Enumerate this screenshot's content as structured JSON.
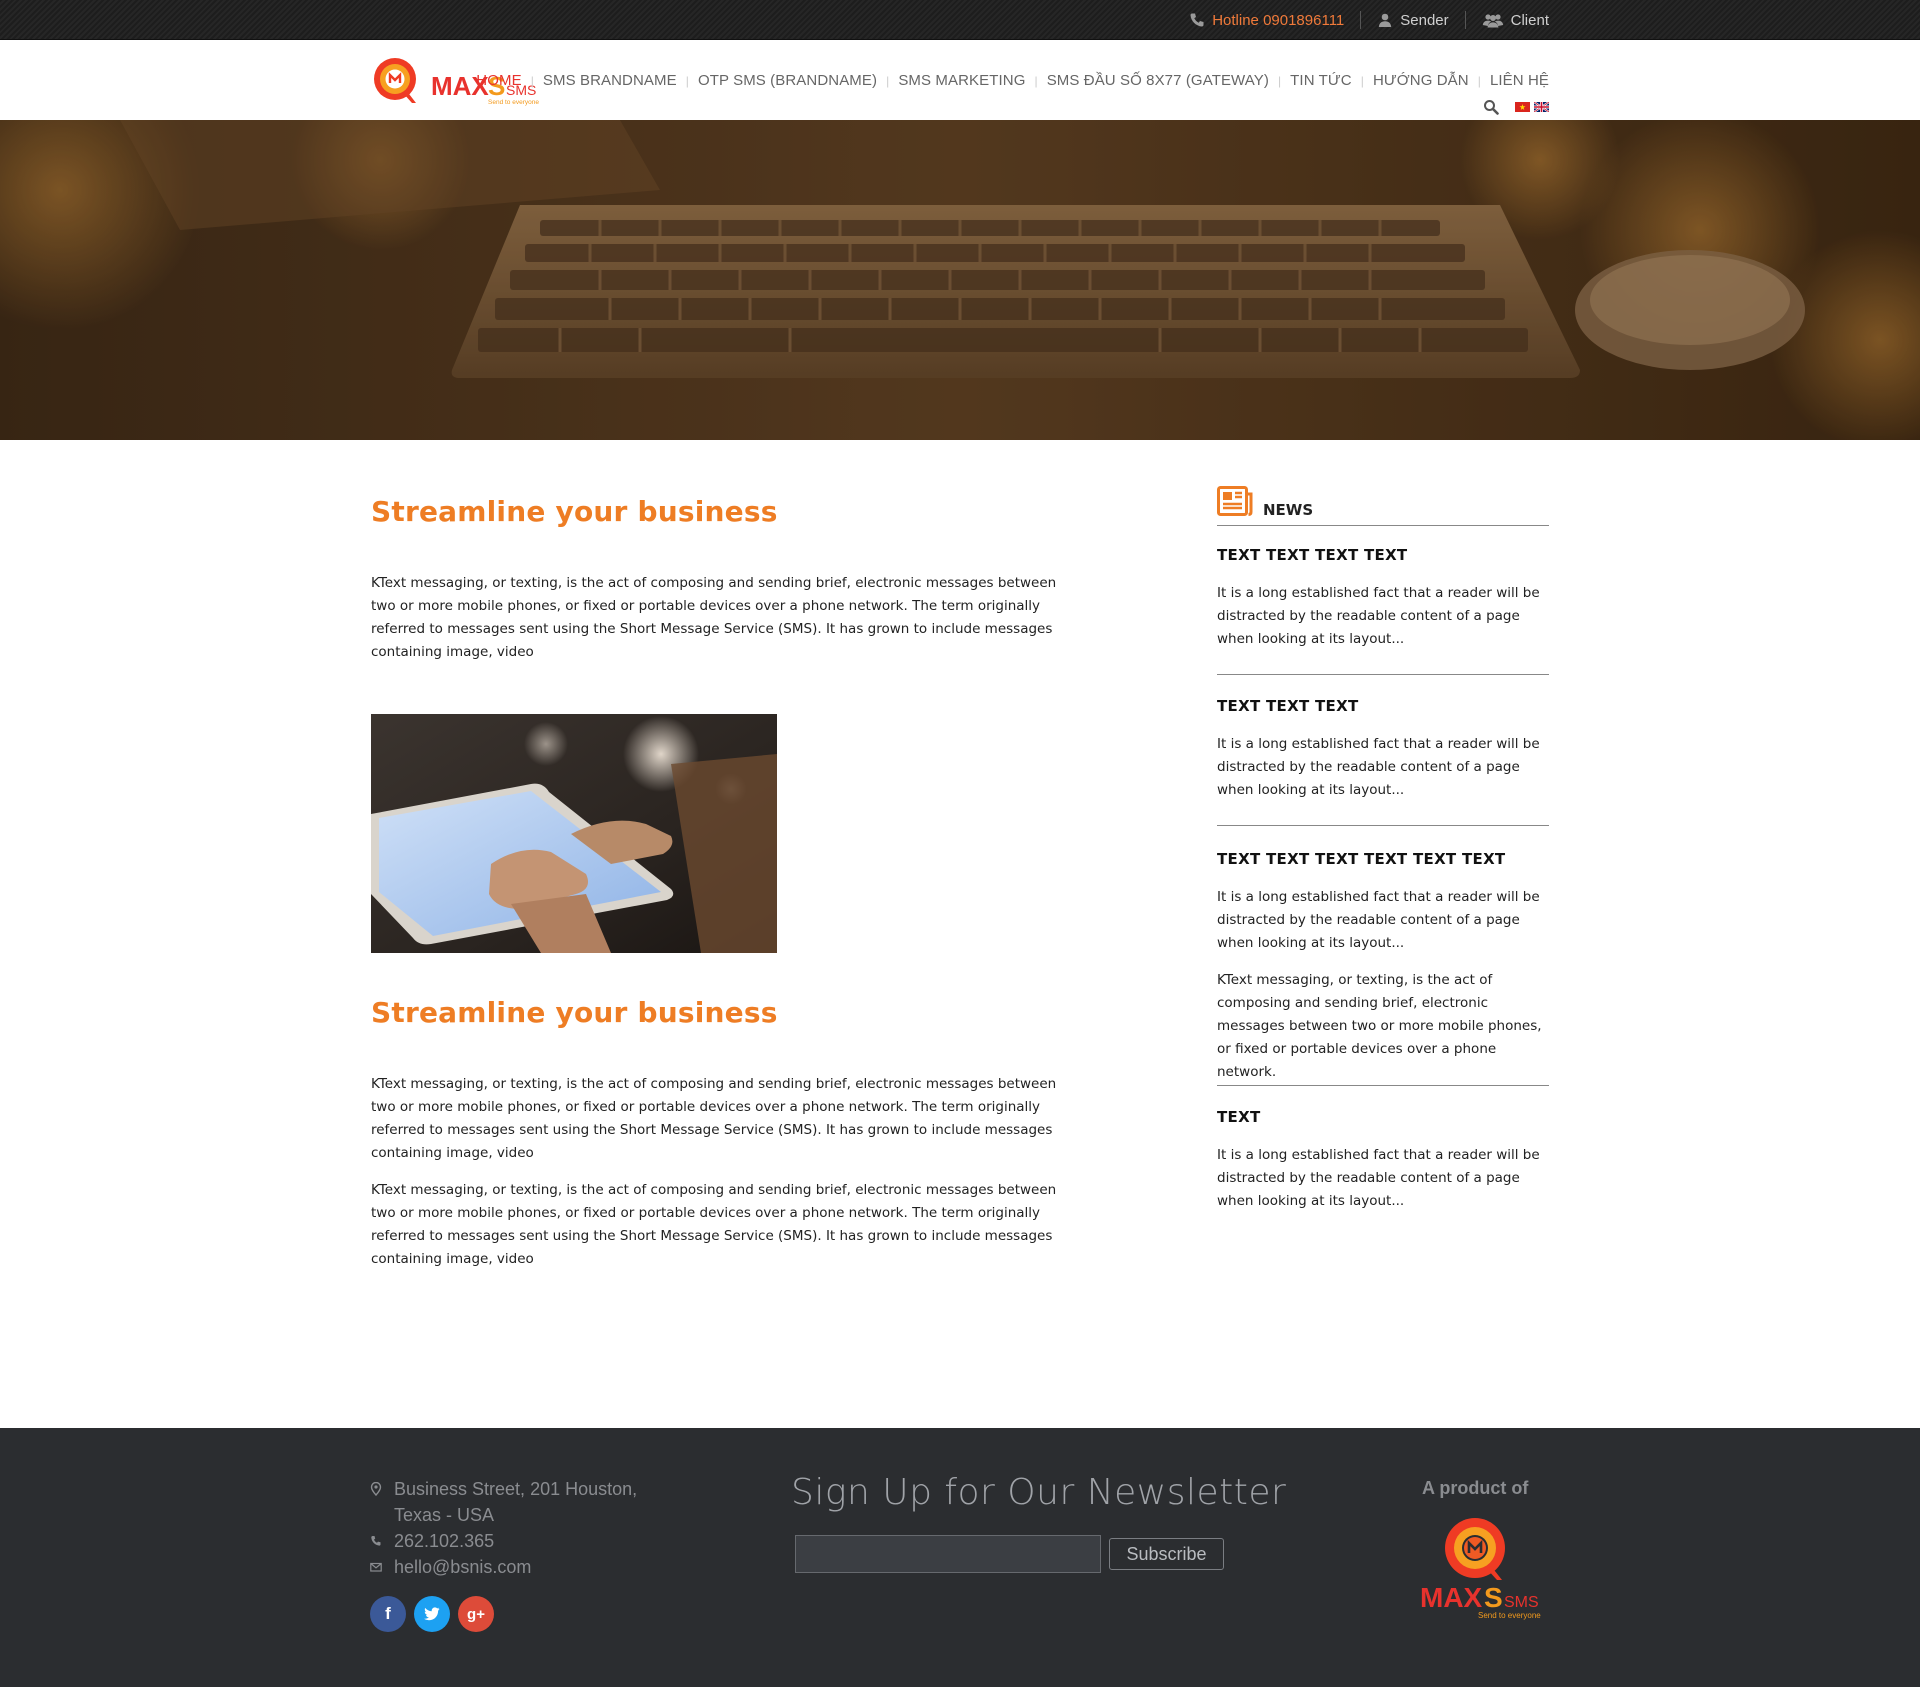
{
  "topbar": {
    "hotline": "Hotline 0901896111",
    "sender": "Sender",
    "client": "Client"
  },
  "brand": {
    "logo_main": "MAX",
    "logo_s": "S",
    "logo_sms": "SMS",
    "logo_tagline": "Send to everyone",
    "accent": "#ee7d24",
    "red": "#e8322d"
  },
  "nav": {
    "items": [
      {
        "label": "HOME",
        "active": true
      },
      {
        "label": "SMS BRANDNAME"
      },
      {
        "label": "OTP SMS (BRANDNAME)"
      },
      {
        "label": "SMS MARKETING"
      },
      {
        "label": "SMS ĐẦU SỐ 8X77 (GATEWAY)"
      },
      {
        "label": "TIN TỨC"
      },
      {
        "label": "HƯỚNG DẪN"
      },
      {
        "label": "LIÊN HỆ"
      }
    ],
    "search_icon": "search-icon",
    "flags": [
      "flag-vietnam-icon",
      "flag-uk-icon"
    ]
  },
  "main": {
    "section1": {
      "title": "Streamline your business",
      "paragraph": "KText messaging, or texting, is the act of composing and sending brief, electronic messages between two or more mobile phones, or fixed or portable devices over a phone network. The term originally referred to messages sent using the Short Message Service (SMS). It has grown to include messages containing image, video"
    },
    "section2": {
      "title": "Streamline your business",
      "paragraph1": "KText messaging, or texting, is the act of composing and sending brief, electronic messages between two or more mobile phones, or fixed or portable devices over a phone network. The term originally referred to messages sent using the Short Message Service (SMS). It has grown to include messages containing image, video",
      "paragraph2": "KText messaging, or texting, is the act of composing and sending brief, electronic messages between two or more mobile phones, or fixed or portable devices over a phone network. The term originally referred to messages sent using the Short Message Service (SMS). It has grown to include messages containing image, video"
    }
  },
  "sidebar": {
    "title": "NEWS",
    "items": [
      {
        "title": "TEXT TEXT TEXT TEXT",
        "excerpt": "It is a long established fact that a reader will be distracted by the readable content of a page when looking at its layout..."
      },
      {
        "title": "TEXT TEXT TEXT",
        "excerpt": "It is a long established fact that a reader will be distracted by the readable content of a page when looking at its layout..."
      },
      {
        "title": "TEXT TEXT TEXT TEXT TEXT TEXT",
        "excerpt": "It is a long established fact that a reader will be distracted by the readable content of a page when looking at its layout...",
        "extra": "KText messaging, or texting, is the act of composing and sending brief, electronic messages between two or more mobile phones, or fixed or portable devices over a phone network."
      },
      {
        "title": "TEXT",
        "excerpt": "It is a long established fact that a reader will be distracted by the readable content of a page when looking at its layout..."
      }
    ]
  },
  "footer": {
    "address_line1": "Business Street, 201 Houston,",
    "address_line2": "Texas - USA",
    "phone": "262.102.365",
    "email": "hello@bsnis.com",
    "newsletter_title": "Sign Up for Our Newsletter",
    "newsletter_placeholder": "",
    "subscribe_label": "Subscribe",
    "product_of": "A product of",
    "social": {
      "facebook": "f",
      "twitter": "t",
      "google": "g+"
    }
  }
}
